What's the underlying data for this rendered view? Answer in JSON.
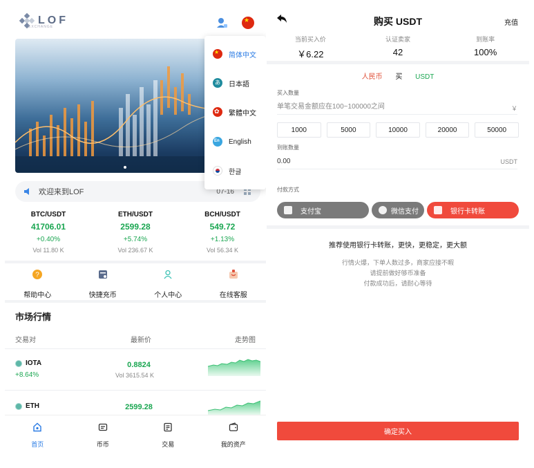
{
  "left": {
    "logo_text": "LOF",
    "logo_sub": "EXCHANGE",
    "notice": {
      "text": "欢迎来到LOF",
      "date": "07-16"
    },
    "tickers": [
      {
        "pair": "BTC/USDT",
        "price": "41706.01",
        "change": "+0.40%",
        "vol": "Vol 11.80 K"
      },
      {
        "pair": "ETH/USDT",
        "price": "2599.28",
        "change": "+5.74%",
        "vol": "Vol 236.67 K"
      },
      {
        "pair": "BCH/USDT",
        "price": "549.72",
        "change": "+1.13%",
        "vol": "Vol 56.34 K"
      }
    ],
    "quick": [
      {
        "label": "帮助中心",
        "icon": "help-icon"
      },
      {
        "label": "快捷充币",
        "icon": "deposit-icon"
      },
      {
        "label": "个人中心",
        "icon": "user-icon"
      },
      {
        "label": "在线客服",
        "icon": "service-icon"
      }
    ],
    "market": {
      "title": "市场行情",
      "col_pair": "交易对",
      "col_price": "最新价",
      "col_trend": "走势图",
      "rows": [
        {
          "name": "IOTA",
          "change": "+8.64%",
          "price": "0.8824",
          "vol": "Vol 3615.54 K"
        },
        {
          "name": "ETH",
          "change": "",
          "price": "2599.28",
          "vol": ""
        }
      ]
    },
    "tabs": [
      {
        "label": "首页",
        "icon": "home-icon"
      },
      {
        "label": "币币",
        "icon": "coin-icon"
      },
      {
        "label": "交易",
        "icon": "trade-icon"
      },
      {
        "label": "我的资产",
        "icon": "wallet-icon"
      }
    ],
    "languages": [
      {
        "label": "简体中文",
        "flag": "china-flag-icon"
      },
      {
        "label": "日本語",
        "flag": "japan-icon"
      },
      {
        "label": "繁體中文",
        "flag": "hongkong-flag-icon"
      },
      {
        "label": "English",
        "flag": "english-icon"
      },
      {
        "label": "한글",
        "flag": "korea-flag-icon"
      }
    ],
    "colors": {
      "accent": "#2a7be4",
      "up": "#1aa651"
    }
  },
  "right": {
    "title": "购买 USDT",
    "recharge": "充值",
    "stats": [
      {
        "key": "当前买入价",
        "value": "￥6.22"
      },
      {
        "key": "认证卖家",
        "value": "42"
      },
      {
        "key": "到账率",
        "value": "100%"
      }
    ],
    "pair": {
      "from": "人民币",
      "action": "买",
      "to": "USDT"
    },
    "buy_amount": {
      "label": "买入数量",
      "placeholder": "单笔交易金额应在100~100000之间",
      "suffix": "￥"
    },
    "amounts": [
      "1000",
      "5000",
      "10000",
      "20000",
      "50000"
    ],
    "receive": {
      "label": "到账数量",
      "value": "0.00",
      "suffix": "USDT"
    },
    "pay": {
      "label": "付款方式",
      "methods": [
        {
          "label": "支付宝",
          "color": "#7a7a7a"
        },
        {
          "label": "微信支付",
          "color": "#7a7a7a"
        },
        {
          "label": "银行卡转账",
          "color": "#f04a3c"
        }
      ]
    },
    "recommend": {
      "title": "推荐使用银行卡转账，更快，更稳定，更大额",
      "lines": [
        "行情火爆，下单人数过多，商家应接不暇",
        "请提前做好够币准备",
        "付款成功后，请耐心等待"
      ]
    },
    "confirm": "确定买入"
  }
}
